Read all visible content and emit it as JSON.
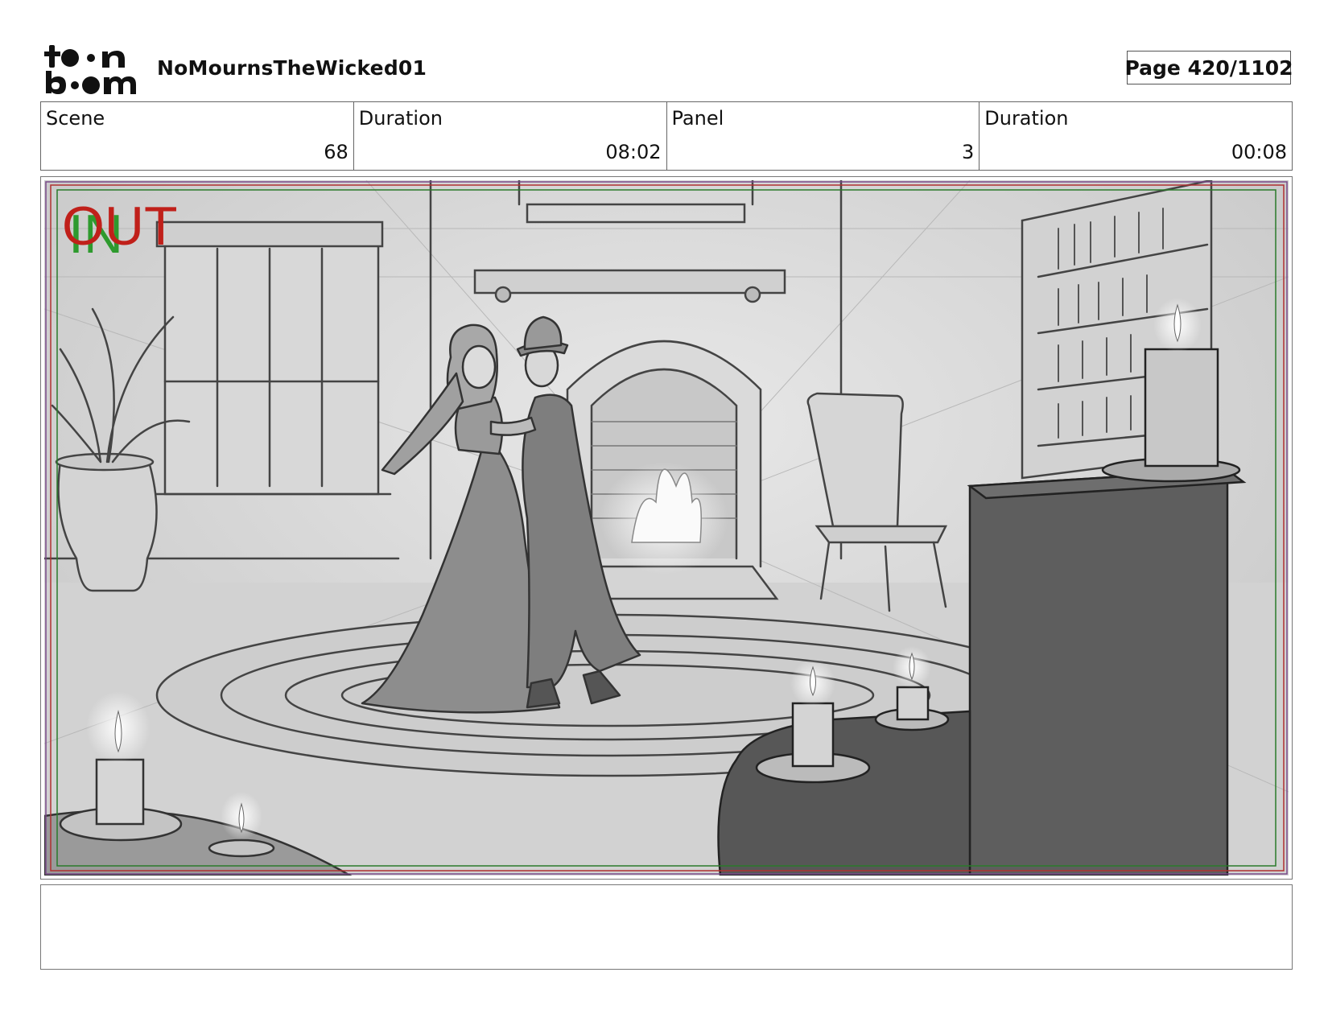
{
  "header": {
    "logo_text": "toon boom",
    "project_name": "NoMournsTheWicked01",
    "page_label": "Page",
    "page_number": "420/1102"
  },
  "info": [
    {
      "label": "Scene",
      "value": "68"
    },
    {
      "label": "Duration",
      "value": "08:02"
    },
    {
      "label": "Panel",
      "value": "3"
    },
    {
      "label": "Duration",
      "value": "00:08"
    }
  ],
  "panel": {
    "overlay_in": "IN",
    "overlay_out": "OUT",
    "overlay_in_color": "#2e9a2e",
    "overlay_out_color": "#c0201a",
    "safe_frame_color": "#2a7a2a",
    "outer_frame_color": "#b03030"
  },
  "notes": {
    "text": ""
  }
}
